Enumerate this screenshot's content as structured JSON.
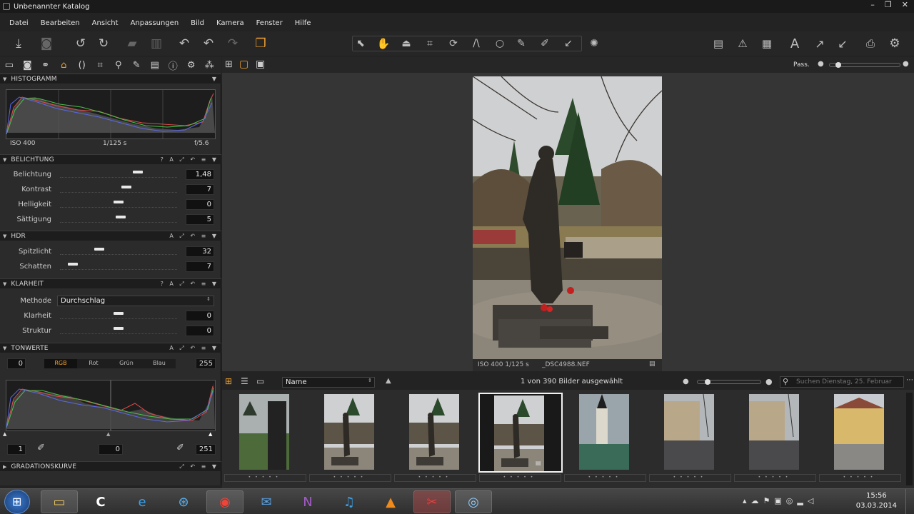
{
  "window": {
    "title": "Unbenannter Katalog",
    "controls": [
      "–",
      "❐",
      "✕"
    ]
  },
  "menu": [
    "Datei",
    "Bearbeiten",
    "Ansicht",
    "Anpassungen",
    "Bild",
    "Kamera",
    "Fenster",
    "Hilfe"
  ],
  "toolbar": {
    "left_icons": [
      "import-icon",
      "camera-icon",
      "rotate-left-icon",
      "rotate-right-icon",
      "move-folder-icon",
      "trash-icon",
      "undo-all-icon",
      "undo-icon",
      "redo-icon",
      "stack-icon"
    ],
    "cursor_tools": [
      "select-icon",
      "hand-icon",
      "stamp-icon",
      "crop-icon",
      "rotate-tool-icon",
      "keystone-icon",
      "circle-icon",
      "brush-icon",
      "picker-icon",
      "arrow-tool-icon"
    ],
    "right_icons": [
      "proof-icon",
      "warning-icon",
      "grid-icon",
      "text-icon",
      "copy-arrow-icon",
      "paste-arrow-icon",
      "print-icon",
      "settings-icon"
    ]
  },
  "tool_tabs": [
    "folder-icon",
    "camera-icon",
    "color-icon",
    "exposure-icon",
    "lens-icon",
    "crop-icon",
    "zoom-icon",
    "brush-icon",
    "meta-icon",
    "info-icon",
    "gear-icon",
    "batch-icon"
  ],
  "view_tabs": [
    "grid-view-icon",
    "single-view-icon",
    "fullscreen-icon"
  ],
  "pass_label": "Pass.",
  "histogram": {
    "title": "HISTOGRAMM",
    "iso": "ISO 400",
    "shutter": "1/125 s",
    "aperture": "f/5.6"
  },
  "belichtung": {
    "title": "BELICHTUNG",
    "rows": [
      {
        "label": "Belichtung",
        "value": "1,48",
        "pos": 0.68
      },
      {
        "label": "Kontrast",
        "value": "7",
        "pos": 0.57
      },
      {
        "label": "Helligkeit",
        "value": "0",
        "pos": 0.5
      },
      {
        "label": "Sättigung",
        "value": "5",
        "pos": 0.52
      }
    ]
  },
  "hdr": {
    "title": "HDR",
    "rows": [
      {
        "label": "Spitzlicht",
        "value": "32",
        "pos": 0.32
      },
      {
        "label": "Schatten",
        "value": "7",
        "pos": 0.07
      }
    ]
  },
  "klarheit": {
    "title": "KLARHEIT",
    "methode_label": "Methode",
    "methode_value": "Durchschlag",
    "rows": [
      {
        "label": "Klarheit",
        "value": "0",
        "pos": 0.5
      },
      {
        "label": "Struktur",
        "value": "0",
        "pos": 0.5
      }
    ]
  },
  "tonwerte": {
    "title": "TONWERTE",
    "min_in": "0",
    "max_in": "255",
    "channels": [
      "RGB",
      "Rot",
      "Grün",
      "Blau"
    ],
    "out_low": "1",
    "out_mid": "0",
    "out_high": "251"
  },
  "gradation": {
    "title": "GRADATIONSKURVE"
  },
  "photo_info": {
    "exif": "ISO 400 1/125 s",
    "filename": "_DSC4988.NEF"
  },
  "browser": {
    "sort": "Name",
    "count": "1 von 390 Bilder ausgewählt",
    "search_placeholder": "Suchen Dienstag, 25. Februar",
    "thumbs": [
      {
        "kind": "statue-side"
      },
      {
        "kind": "statue"
      },
      {
        "kind": "statue"
      },
      {
        "kind": "statue",
        "selected": true
      },
      {
        "kind": "church"
      },
      {
        "kind": "building"
      },
      {
        "kind": "building"
      },
      {
        "kind": "yellow-building"
      }
    ]
  },
  "taskbar": {
    "apps": [
      "explorer-icon",
      "capture-one-icon",
      "ie-icon",
      "safari-icon",
      "chrome-icon",
      "thunderbird-icon",
      "onenote-icon",
      "itunes-icon",
      "vlc-icon",
      "snipping-icon",
      "capture-one-pro-icon"
    ],
    "time": "15:56",
    "date": "03.03.2014"
  }
}
